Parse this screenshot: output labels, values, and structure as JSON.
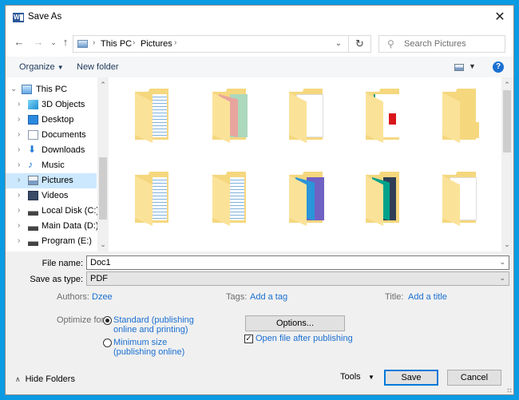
{
  "window": {
    "title": "Save As",
    "app_icon": "word-icon",
    "close_icon": "close-icon"
  },
  "navigation": {
    "back_icon": "arrow-left-icon",
    "forward_icon": "arrow-right-icon",
    "recent_icon": "chevron-down-icon",
    "up_icon": "arrow-up-icon",
    "breadcrumb": [
      "This PC",
      "Pictures"
    ],
    "refresh_icon": "refresh-icon",
    "search_placeholder": "Search Pictures"
  },
  "toolbar": {
    "organize_label": "Organize",
    "new_folder_label": "New folder",
    "help_label": "?"
  },
  "tree": {
    "items": [
      {
        "label": "This PC",
        "icon": "computer-icon",
        "expanded": true,
        "level": 0
      },
      {
        "label": "3D Objects",
        "icon": "3d-objects-icon",
        "level": 1
      },
      {
        "label": "Desktop",
        "icon": "desktop-icon",
        "level": 1
      },
      {
        "label": "Documents",
        "icon": "documents-icon",
        "level": 1
      },
      {
        "label": "Downloads",
        "icon": "downloads-icon",
        "level": 1
      },
      {
        "label": "Music",
        "icon": "music-icon",
        "level": 1
      },
      {
        "label": "Pictures",
        "icon": "pictures-icon",
        "level": 1,
        "selected": true
      },
      {
        "label": "Videos",
        "icon": "videos-icon",
        "level": 1
      },
      {
        "label": "Local Disk (C:)",
        "icon": "drive-c-icon",
        "level": 1
      },
      {
        "label": "Main Data (D:)",
        "icon": "drive-icon",
        "level": 1
      },
      {
        "label": "Program (E:)",
        "icon": "drive-icon",
        "level": 1
      }
    ]
  },
  "folders": [
    {
      "preview": "document-pages",
      "colors": [
        "#ffffff",
        "#7fb2e0"
      ]
    },
    {
      "preview": "colored-sheets",
      "colors": [
        "#e8a59e",
        "#acd8bc"
      ]
    },
    {
      "preview": "white-document",
      "colors": [
        "#ffffff",
        "#dddddd"
      ]
    },
    {
      "preview": "pdf-document",
      "colors": [
        "#ffffff",
        "#d8161b"
      ]
    },
    {
      "preview": "empty",
      "colors": []
    },
    {
      "preview": "document-pages",
      "colors": [
        "#ffffff",
        "#7fb2e0"
      ]
    },
    {
      "preview": "document-pages",
      "colors": [
        "#ffffff",
        "#7fb2e0"
      ]
    },
    {
      "preview": "colored-sheets",
      "colors": [
        "#2a95d9",
        "#7062c3"
      ]
    },
    {
      "preview": "photo",
      "colors": [
        "#00a28a",
        "#2f3d56"
      ]
    },
    {
      "preview": "white-document",
      "colors": [
        "#ffffff",
        "#eeeeee"
      ]
    }
  ],
  "form": {
    "file_name_label": "File name:",
    "file_name_value": "Doc1",
    "save_as_type_label": "Save as type:",
    "save_as_type_value": "PDF",
    "authors_label": "Authors:",
    "authors_value": "Dzee",
    "tags_label": "Tags:",
    "tags_value": "Add a tag",
    "title_label": "Title:",
    "title_value": "Add a title",
    "optimize_label": "Optimize for:",
    "optimize_options": [
      {
        "line1": "Standard (publishing",
        "line2": "online and printing)",
        "checked": true
      },
      {
        "line1": "Minimum size",
        "line2": "(publishing online)",
        "checked": false
      }
    ],
    "options_button": "Options...",
    "open_after_label": "Open file after publishing",
    "open_after_checked": true
  },
  "footer": {
    "hide_folders_label": "Hide Folders",
    "tools_label": "Tools",
    "save_label": "Save",
    "cancel_label": "Cancel"
  },
  "colors": {
    "accent": "#0078d7",
    "link": "#1a6fd1",
    "selection": "#cce8ff",
    "frame": "#0a9be3"
  }
}
